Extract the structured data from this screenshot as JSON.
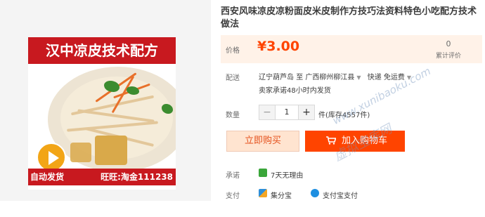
{
  "product": {
    "title": "西安风味凉皮凉粉面皮米皮制作方技巧法资料特色小吃配方技术做法",
    "image": {
      "banner_text": "汉中凉皮技术配方",
      "badge_left": "自动发货",
      "badge_right": "旺旺:淘金111238"
    }
  },
  "price": {
    "label": "价格",
    "value": "¥3.00",
    "review_count": "0",
    "review_label": "累计评价"
  },
  "shipping": {
    "label": "配送",
    "from": "辽宁葫芦岛",
    "to_word": "至",
    "destination": "广西柳州柳江县",
    "method": "快递 免运费",
    "promise": "卖家承诺48小时内发货"
  },
  "quantity": {
    "label": "数量",
    "minus": "−",
    "value": "1",
    "plus": "+",
    "stock": "件(库存4557件)"
  },
  "actions": {
    "buy_now": "立即购买",
    "add_to_cart": "加入购物车"
  },
  "commitment": {
    "label": "承诺",
    "item": "7天无理由"
  },
  "payment": {
    "label": "支付",
    "methods": [
      "集分宝",
      "支付宝支付"
    ]
  },
  "watermark": {
    "url": "www.xunibaoku.com",
    "name": "虚拟宝库网"
  },
  "colors": {
    "accent": "#ff4400",
    "price_bg": "#fff2e8",
    "banner_red": "#c8191f",
    "commitment_green": "#3aa63a"
  }
}
